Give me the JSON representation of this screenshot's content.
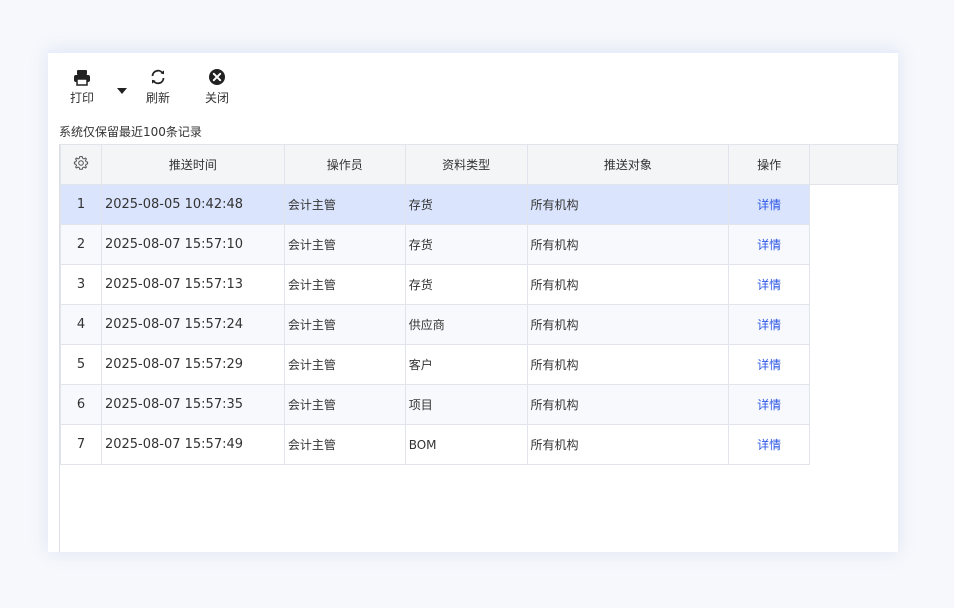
{
  "toolbar": {
    "print_label": "打印",
    "refresh_label": "刷新",
    "close_label": "关闭"
  },
  "notice": "系统仅保留最近100条记录",
  "table": {
    "columns": [
      "推送时间",
      "操作员",
      "资料类型",
      "推送对象",
      "操作"
    ],
    "rows": [
      {
        "index": "1",
        "time": "2025-08-05 10:42:48",
        "operator": "会计主管",
        "type": "存货",
        "target": "所有机构",
        "action": "详情"
      },
      {
        "index": "2",
        "time": "2025-08-07 15:57:10",
        "operator": "会计主管",
        "type": "存货",
        "target": "所有机构",
        "action": "详情"
      },
      {
        "index": "3",
        "time": "2025-08-07 15:57:13",
        "operator": "会计主管",
        "type": "存货",
        "target": "所有机构",
        "action": "详情"
      },
      {
        "index": "4",
        "time": "2025-08-07 15:57:24",
        "operator": "会计主管",
        "type": "供应商",
        "target": "所有机构",
        "action": "详情"
      },
      {
        "index": "5",
        "time": "2025-08-07 15:57:29",
        "operator": "会计主管",
        "type": "客户",
        "target": "所有机构",
        "action": "详情"
      },
      {
        "index": "6",
        "time": "2025-08-07 15:57:35",
        "operator": "会计主管",
        "type": "项目",
        "target": "所有机构",
        "action": "详情"
      },
      {
        "index": "7",
        "time": "2025-08-07 15:57:49",
        "operator": "会计主管",
        "type": "BOM",
        "target": "所有机构",
        "action": "详情"
      }
    ],
    "selected_row": 0
  },
  "colors": {
    "link": "#2e57e6",
    "selected_row": "#dae4fc",
    "header_bg": "#f4f5f7"
  },
  "icons": {
    "print": "printer-icon",
    "print_menu": "caret-down-icon",
    "refresh": "refresh-icon",
    "close": "close-circle-icon",
    "settings": "gear-icon"
  }
}
